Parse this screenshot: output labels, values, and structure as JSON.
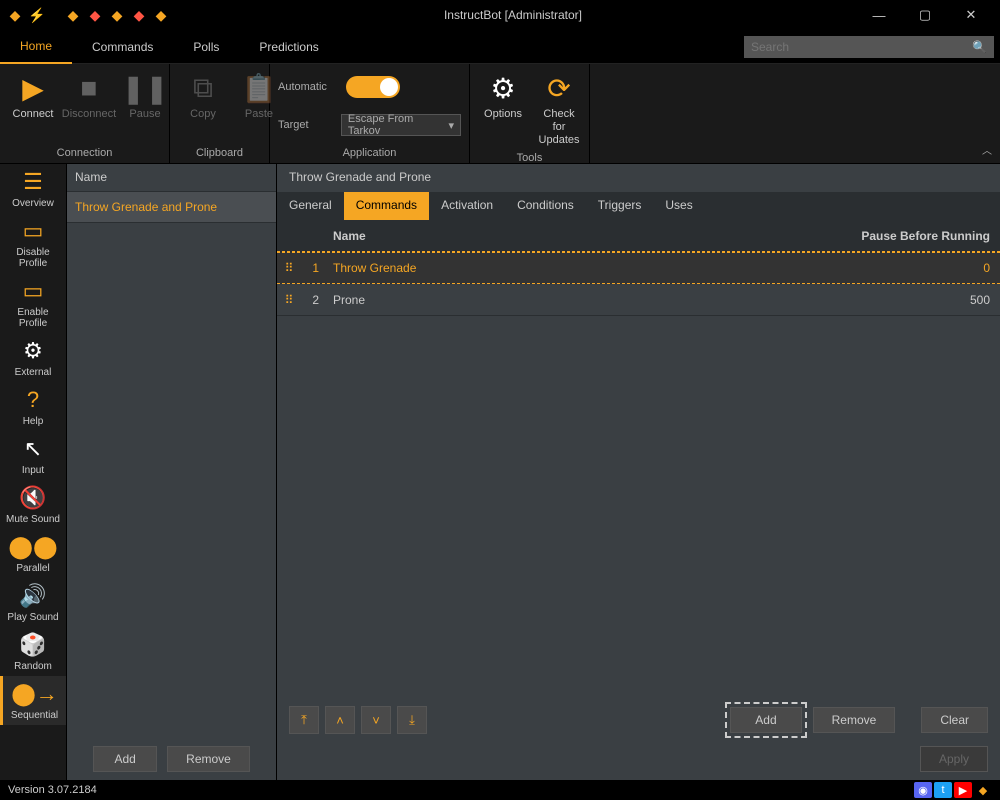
{
  "window": {
    "title": "InstructBot [Administrator]"
  },
  "mainTabs": {
    "items": [
      "Home",
      "Commands",
      "Polls",
      "Predictions"
    ],
    "active": "Home"
  },
  "search": {
    "placeholder": "Search"
  },
  "ribbon": {
    "connection": {
      "label": "Connection",
      "connect": "Connect",
      "disconnect": "Disconnect",
      "pause": "Pause"
    },
    "clipboard": {
      "label": "Clipboard",
      "copy": "Copy",
      "paste": "Paste"
    },
    "application": {
      "label": "Application",
      "automatic": "Automatic",
      "target": "Target",
      "targetValue": "Escape From Tarkov"
    },
    "tools": {
      "label": "Tools",
      "options": "Options",
      "updates": "Check for\nUpdates"
    }
  },
  "sidebar": {
    "items": [
      {
        "label": "Overview"
      },
      {
        "label": "Disable Profile"
      },
      {
        "label": "Enable Profile"
      },
      {
        "label": "External"
      },
      {
        "label": "Help"
      },
      {
        "label": "Input"
      },
      {
        "label": "Mute Sound"
      },
      {
        "label": "Parallel"
      },
      {
        "label": "Play Sound"
      },
      {
        "label": "Random"
      },
      {
        "label": "Sequential"
      }
    ],
    "active": "Sequential"
  },
  "middle": {
    "header": "Name",
    "items": [
      "Throw Grenade and Prone"
    ],
    "add": "Add",
    "remove": "Remove"
  },
  "content": {
    "title": "Throw Grenade and Prone",
    "tabs": [
      "General",
      "Commands",
      "Activation",
      "Conditions",
      "Triggers",
      "Uses"
    ],
    "activeTab": "Commands",
    "headers": {
      "name": "Name",
      "pause": "Pause Before Running"
    },
    "rows": [
      {
        "idx": "1",
        "name": "Throw Grenade",
        "pause": "0"
      },
      {
        "idx": "2",
        "name": "Prone",
        "pause": "500"
      }
    ],
    "buttons": {
      "add": "Add",
      "remove": "Remove",
      "clear": "Clear",
      "apply": "Apply"
    }
  },
  "status": {
    "version": "Version 3.07.2184"
  }
}
